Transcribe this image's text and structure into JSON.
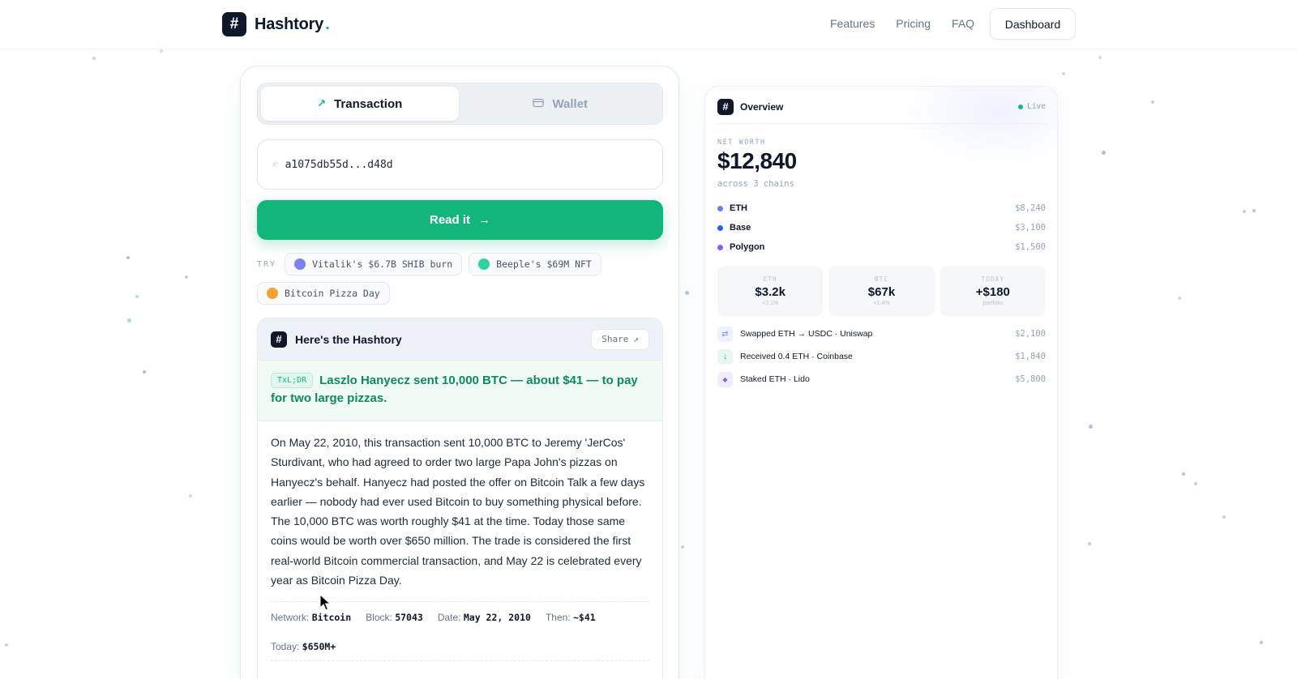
{
  "brand": {
    "name": "Hashtory",
    "mark": "#",
    "dot": "."
  },
  "nav": {
    "items": [
      "Features",
      "Pricing",
      "FAQ"
    ],
    "dashboard": "Dashboard"
  },
  "colors": {
    "accent": "#12b67a",
    "dark": "#0f172a",
    "muted": "#94a3b8"
  },
  "lookup": {
    "tabs": [
      {
        "label": "Transaction",
        "icon": "arrow-up-right-icon",
        "active": true
      },
      {
        "label": "Wallet",
        "icon": "wallet-icon",
        "active": false
      }
    ],
    "input_value": "a1075db55d...d48d",
    "read_button": "Read it",
    "try_label": "TRY",
    "examples": [
      {
        "label": "Vitalik's $6.7B SHIB burn",
        "color": "#7c83f0"
      },
      {
        "label": "Beeple's $69M NFT",
        "color": "#2dd4a0"
      },
      {
        "label": "Bitcoin Pizza Day",
        "color": "#f7a234"
      }
    ]
  },
  "result": {
    "title": "Here's the Hashtory",
    "share": "Share",
    "tldr_badge": "TxL;DR",
    "tldr": "Laszlo Hanyecz sent 10,000 BTC — about $41 — to pay for two large pizzas.",
    "body": "On May 22, 2010, this transaction sent 10,000 BTC to Jeremy 'JerCos' Sturdivant, who had agreed to order two large Papa John's pizzas on Hanyecz's behalf. Hanyecz had posted the offer on Bitcoin Talk a few days earlier — nobody had ever used Bitcoin to buy something physical before. The 10,000 BTC was worth roughly $41 at the time. Today those same coins would be worth over $650 million. The trade is considered the first real-world Bitcoin commercial transaction, and May 22 is celebrated every year as Bitcoin Pizza Day.",
    "meta": [
      {
        "label": "Network:",
        "value": "Bitcoin"
      },
      {
        "label": "Block:",
        "value": "57043"
      },
      {
        "label": "Date:",
        "value": "May 22, 2010"
      },
      {
        "label": "Then:",
        "value": "~$41"
      },
      {
        "label": "Today:",
        "value": "$650M+"
      }
    ]
  },
  "overview": {
    "title": "Overview",
    "live": "Live",
    "net_worth_label": "NET WORTH",
    "net_worth": "$12,840",
    "net_worth_sub": "across 3 chains",
    "chains": [
      {
        "name": "ETH",
        "value": "$8,240",
        "color": "#6b7cf0"
      },
      {
        "name": "Base",
        "value": "$3,100",
        "color": "#2563eb"
      },
      {
        "name": "Polygon",
        "value": "$1,500",
        "color": "#8b5cf6"
      }
    ],
    "stats": [
      {
        "label": "ETH",
        "value": "$3.2k",
        "sub": "+2.1%"
      },
      {
        "label": "BTC",
        "value": "$67k",
        "sub": "+1.4%"
      },
      {
        "label": "TODAY",
        "value": "+$180",
        "sub": "portfolio"
      }
    ],
    "activity": [
      {
        "icon": "swap-icon",
        "glyph": "⇄",
        "text": "Swapped ETH → USDC · Uniswap",
        "value": "$2,100",
        "bg": "#eef2ff",
        "fg": "#818cf8"
      },
      {
        "icon": "arrow-down-icon",
        "glyph": "↓",
        "text": "Received 0.4 ETH · Coinbase",
        "value": "$1,840",
        "bg": "#e8f8f0",
        "fg": "#10b981"
      },
      {
        "icon": "diamond-icon",
        "glyph": "◆",
        "text": "Staked ETH · Lido",
        "value": "$5,800",
        "bg": "#f1ecfe",
        "fg": "#8b5cf6"
      }
    ]
  }
}
